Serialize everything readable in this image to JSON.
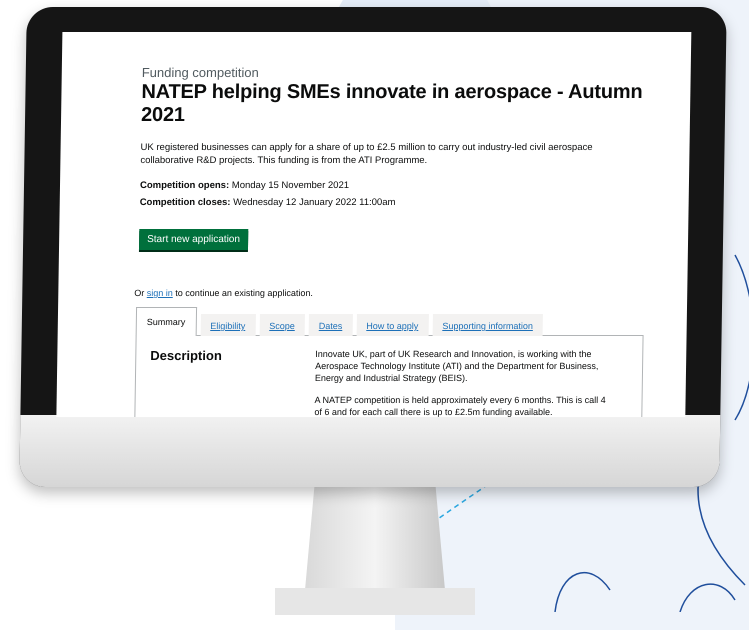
{
  "page": {
    "caption": "Funding competition",
    "title": "NATEP helping SMEs innovate in aerospace - Autumn 2021",
    "intro": "UK registered businesses can apply for a share of up to £2.5 million to carry out industry-led civil aerospace collaborative R&D projects. This funding is from the ATI Programme.",
    "opens_label": "Competition opens:",
    "opens_value": "Monday 15 November 2021",
    "closes_label": "Competition closes:",
    "closes_value": "Wednesday 12 January 2022 11:00am",
    "start_button": "Start new application",
    "signin_prefix": "Or",
    "signin_link": "sign in",
    "signin_suffix": "to continue an existing application."
  },
  "tabs": [
    {
      "label": "Summary",
      "active": true
    },
    {
      "label": "Eligibility"
    },
    {
      "label": "Scope"
    },
    {
      "label": "Dates"
    },
    {
      "label": "How to apply"
    },
    {
      "label": "Supporting information"
    }
  ],
  "panel": {
    "heading": "Description",
    "paragraphs": [
      "Innovate UK, part of UK Research and Innovation, is working with the Aerospace Technology Institute (ATI) and the Department for Business, Energy and Industrial Strategy (BEIS).",
      "A NATEP competition is held approximately every 6 months. This is call 4 of 6 and for each call there is up to £2.5m funding available."
    ]
  },
  "colors": {
    "button_green": "#00703c",
    "link_blue": "#1d70b8",
    "deco_line": "#1f4e9c",
    "deco_dash": "#2aa7e0",
    "backdrop": "#eef3fa"
  }
}
